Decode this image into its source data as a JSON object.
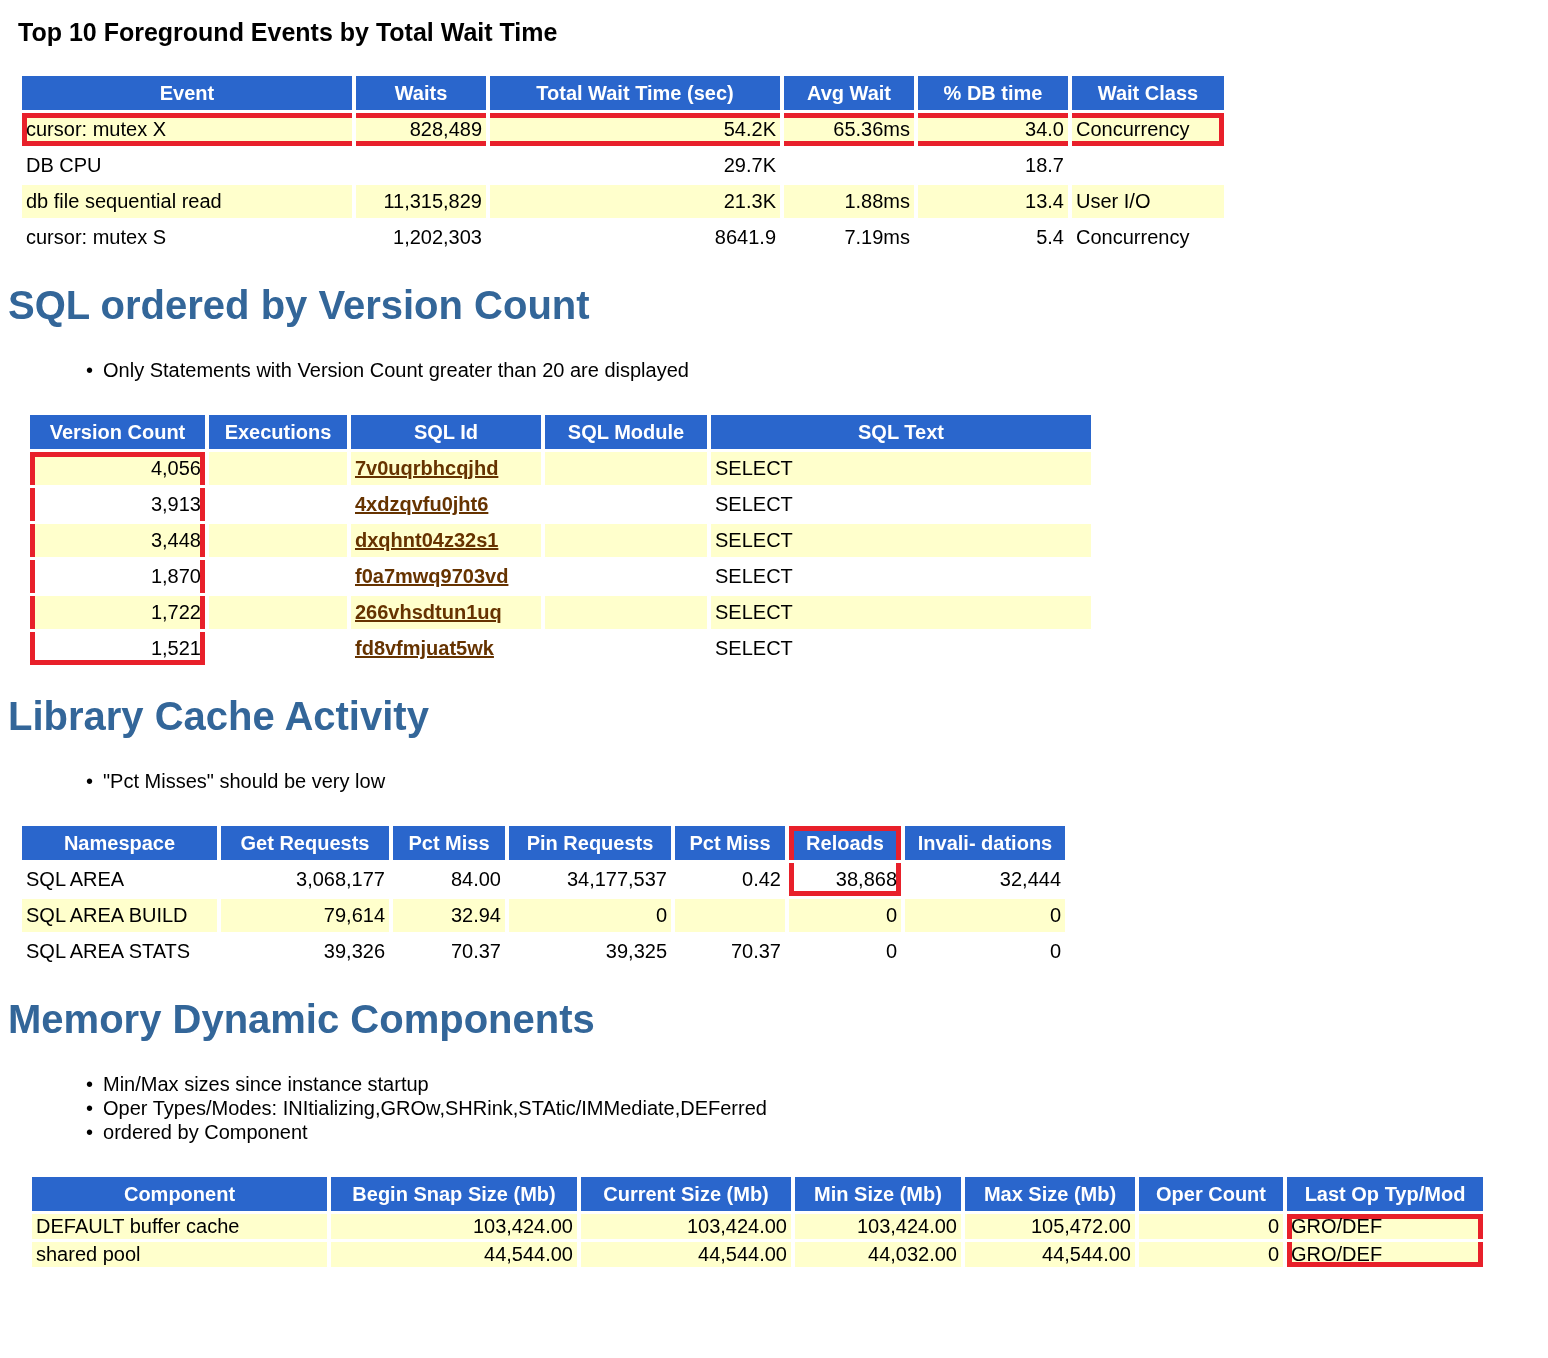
{
  "sections": [
    {
      "heading": "Top 10 Foreground Events by Total Wait Time",
      "table": {
        "columns": [
          {
            "label": "Event",
            "kind": "text"
          },
          {
            "label": "Waits",
            "kind": "number"
          },
          {
            "label": "Total Wait Time (sec)",
            "kind": "number"
          },
          {
            "label": "Avg Wait",
            "kind": "number"
          },
          {
            "label": "% DB time",
            "kind": "number"
          },
          {
            "label": "Wait Class",
            "kind": "text"
          }
        ],
        "rows": [
          {
            "shaded": true,
            "cells": [
              {
                "text": "cursor: mutex X",
                "highlighted": true
              },
              {
                "text": "828,489",
                "highlighted": true
              },
              {
                "text": "54.2K",
                "highlighted": true
              },
              {
                "text": "65.36ms",
                "highlighted": true
              },
              {
                "text": "34.0",
                "highlighted": true
              },
              {
                "text": "Concurrency",
                "highlighted": true
              }
            ]
          },
          {
            "shaded": false,
            "cells": [
              "DB CPU",
              null,
              "29.7K",
              null,
              "18.7",
              null
            ]
          },
          {
            "shaded": true,
            "cells": [
              "db file sequential read",
              "11,315,829",
              "21.3K",
              "1.88ms",
              "13.4",
              "User I/O"
            ]
          },
          {
            "shaded": false,
            "cells": [
              "cursor: mutex S",
              "1,202,303",
              "8641.9",
              "7.19ms",
              "5.4",
              "Concurrency"
            ]
          }
        ]
      }
    },
    {
      "heading": "SQL ordered by Version Count",
      "notes": [
        {
          "marker": "•",
          "text": "Only Statements with Version Count greater than 20 are displayed"
        }
      ],
      "table": {
        "columns": [
          {
            "label": "Version Count",
            "kind": "number"
          },
          {
            "label": "Executions",
            "kind": "number"
          },
          {
            "label": "SQL Id",
            "kind": "link"
          },
          {
            "label": "SQL Module",
            "kind": "text"
          },
          {
            "label": "SQL Text",
            "kind": "text"
          }
        ],
        "rows": [
          {
            "shaded": true,
            "cells": [
              {
                "text": "4,056",
                "highlighted": true
              },
              null,
              "7v0uqrbhcqjhd",
              null,
              "SELECT"
            ]
          },
          {
            "shaded": false,
            "cells": [
              {
                "text": "3,913",
                "highlighted": true
              },
              null,
              "4xdzqvfu0jht6",
              null,
              "SELECT"
            ]
          },
          {
            "shaded": true,
            "cells": [
              {
                "text": "3,448",
                "highlighted": true
              },
              null,
              "dxqhnt04z32s1",
              null,
              "SELECT"
            ]
          },
          {
            "shaded": false,
            "cells": [
              {
                "text": "1,870",
                "highlighted": true
              },
              null,
              "f0a7mwq9703vd",
              null,
              "SELECT"
            ]
          },
          {
            "shaded": true,
            "cells": [
              {
                "text": "1,722",
                "highlighted": true
              },
              null,
              "266vhsdtun1uq",
              null,
              "SELECT"
            ]
          },
          {
            "shaded": false,
            "cells": [
              {
                "text": "1,521",
                "highlighted": true
              },
              null,
              "fd8vfmjuat5wk",
              null,
              "SELECT"
            ]
          }
        ]
      }
    },
    {
      "heading": "Library Cache Activity",
      "notes": [
        {
          "marker": "•",
          "text": "\"Pct Misses\" should be very low"
        }
      ],
      "table": {
        "columns": [
          {
            "label": "Namespace",
            "kind": "text"
          },
          {
            "label": "Get Requests",
            "kind": "number"
          },
          {
            "label": "Pct Miss",
            "kind": "number"
          },
          {
            "label": "Pin Requests",
            "kind": "number"
          },
          {
            "label": "Pct Miss",
            "kind": "number"
          },
          {
            "label": "Reloads",
            "kind": "number",
            "highlighted": true
          },
          {
            "label": "Invali- dations",
            "kind": "number"
          }
        ],
        "rows": [
          {
            "shaded": false,
            "cells": [
              "SQL AREA",
              "3,068,177",
              "84.00",
              "34,177,537",
              "0.42",
              {
                "text": "38,868",
                "highlighted": true
              },
              "32,444"
            ]
          },
          {
            "shaded": true,
            "cells": [
              "SQL AREA BUILD",
              "79,614",
              "32.94",
              "0",
              null,
              "0",
              "0"
            ]
          },
          {
            "shaded": false,
            "cells": [
              "SQL AREA STATS",
              "39,326",
              "70.37",
              "39,325",
              "70.37",
              "0",
              "0"
            ]
          }
        ]
      }
    },
    {
      "heading": "Memory Dynamic Components",
      "notes": [
        {
          "marker": "•",
          "text": "Min/Max sizes since instance startup"
        },
        {
          "marker": "•",
          "text": "Oper Types/Modes: INItializing,GROw,SHRink,STAtic/IMMediate,DEFerred"
        },
        {
          "marker": "•",
          "text": "ordered by Component"
        }
      ],
      "table": {
        "columns": [
          {
            "label": "Component",
            "kind": "text"
          },
          {
            "label": "Begin Snap Size (Mb)",
            "kind": "number"
          },
          {
            "label": "Current Size (Mb)",
            "kind": "number"
          },
          {
            "label": "Min Size (Mb)",
            "kind": "number"
          },
          {
            "label": "Max Size (Mb)",
            "kind": "number"
          },
          {
            "label": "Oper Count",
            "kind": "number"
          },
          {
            "label": "Last Op Typ/Mod",
            "kind": "text"
          }
        ],
        "rows": [
          {
            "shaded": true,
            "cells": [
              "DEFAULT buffer cache",
              "103,424.00",
              "103,424.00",
              "103,424.00",
              "105,472.00",
              "0",
              {
                "text": "GRO/DEF",
                "highlighted": true
              }
            ]
          },
          {
            "shaded": true,
            "cells": [
              "shared pool",
              "44,544.00",
              "44,544.00",
              "44,032.00",
              "44,544.00",
              "0",
              {
                "text": "GRO/DEF",
                "highlighted": true
              }
            ]
          }
        ]
      }
    }
  ]
}
